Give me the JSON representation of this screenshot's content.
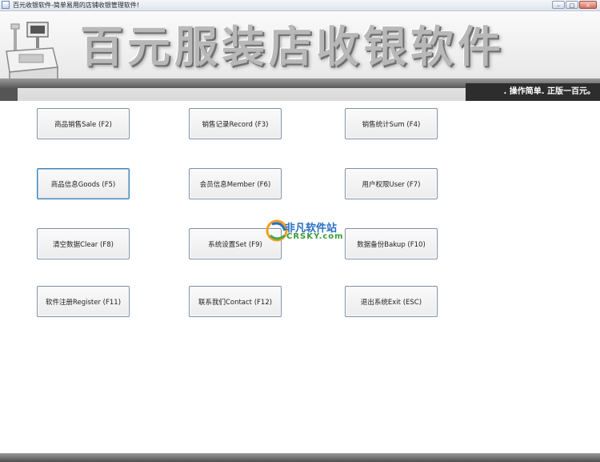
{
  "window": {
    "title": "百元收银软件-简单易用的店铺收银管理软件!",
    "controls": {
      "minimize": "–",
      "maximize": "□",
      "close": "×"
    }
  },
  "banner": {
    "title": "百元服装店收银软件",
    "slogan": ". 操作简单. 正版一百元。"
  },
  "buttons": [
    {
      "label": "商品销售Sale (F2)"
    },
    {
      "label": "销售记录Record (F3)"
    },
    {
      "label": "销售统计Sum (F4)"
    },
    {
      "label": "商品信息Goods (F5)"
    },
    {
      "label": "会员信息Member (F6)"
    },
    {
      "label": "用户权限User (F7)"
    },
    {
      "label": "清空数据Clear (F8)"
    },
    {
      "label": "系统设置Set (F9)"
    },
    {
      "label": "数据备份Bakup (F10)"
    },
    {
      "label": "软件注册Register (F11)"
    },
    {
      "label": "联系我们Contact (F12)"
    },
    {
      "label": "退出系统Exit (ESC)"
    }
  ],
  "watermark": {
    "cn": "非凡软件站",
    "en": "CRSKY.com"
  },
  "colors": {
    "focus_border": "#3c7fb1",
    "slogan_bg": "#2d2d2d"
  }
}
